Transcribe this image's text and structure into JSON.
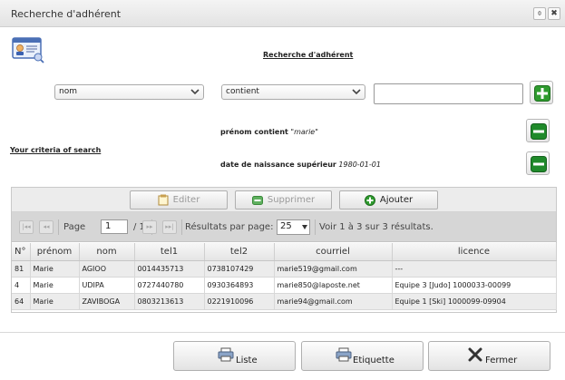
{
  "window": {
    "title": "Recherche d'adhérent",
    "restore_glyph": "⌽",
    "close_glyph": "✖"
  },
  "heading": "Recherche d'adhérent",
  "search": {
    "field_value": "nom",
    "operator_value": "contient",
    "text_value": ""
  },
  "criteria": {
    "label": "Your criteria of search",
    "items": [
      {
        "label": "prénom contient",
        "value": "\"marie\""
      },
      {
        "label": "date de naissance supérieur",
        "value": "1980-01-01"
      }
    ]
  },
  "toolbar": {
    "edit_label": "Editer",
    "delete_label": "Supprimer",
    "add_label": "Ajouter"
  },
  "pager": {
    "first_glyph": "|◂◂",
    "prev_glyph": "◂◂",
    "next_glyph": "▸▸",
    "last_glyph": "▸▸|",
    "page_label": "Page",
    "page_value": "1",
    "page_total": "/ 1",
    "per_page_label": "Résultats par page:",
    "per_page_value": "25",
    "summary": "Voir 1 à 3 sur 3 résultats."
  },
  "table": {
    "columns": [
      "N°",
      "prénom",
      "nom",
      "tel1",
      "tel2",
      "courriel",
      "licence"
    ],
    "rows": [
      [
        "81",
        "Marie",
        "AGIOO",
        "0014435713",
        "0738107429",
        "marie519@gmail.com",
        "---"
      ],
      [
        "4",
        "Marie",
        "UDIPA",
        "0727440780",
        "0930364893",
        "marie850@laposte.net",
        "Equipe 3 [Judo] 1000033-00099"
      ],
      [
        "64",
        "Marie",
        "ZAVIBOGA",
        "0803213613",
        "0221910096",
        "marie94@gmail.com",
        "Equipe 1 [Ski] 1000099-09904"
      ]
    ]
  },
  "footer": {
    "list_label": "Liste",
    "label_label": "Etiquette",
    "close_label": "Fermer"
  },
  "colors": {
    "add_green": "#2e9b2e",
    "remove_green": "#1f8a2a"
  }
}
